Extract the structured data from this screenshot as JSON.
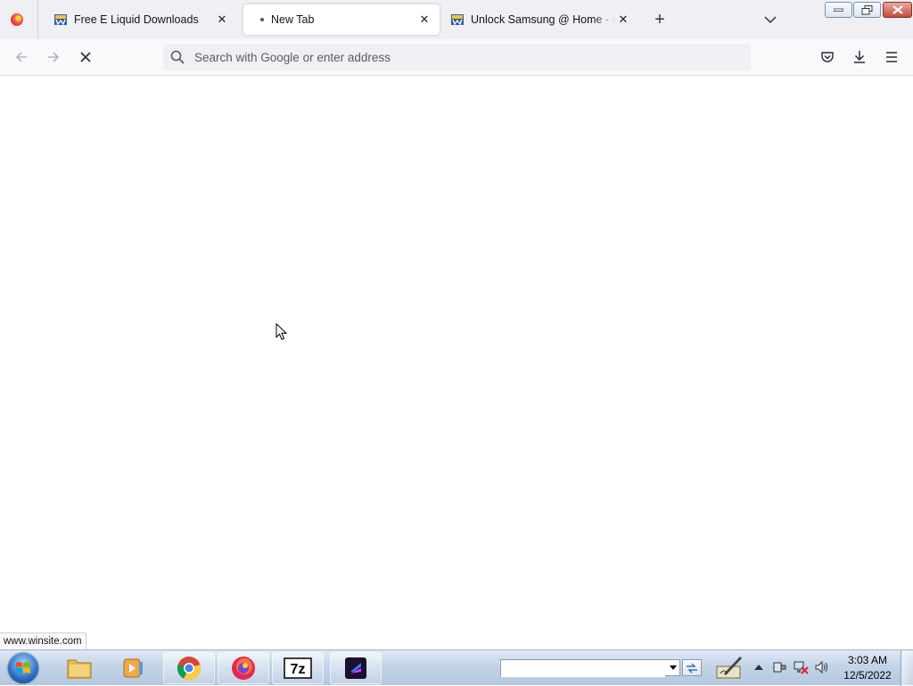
{
  "browser": {
    "tabs": [
      {
        "label": "Free E Liquid Downloads",
        "favicon": "winsite-favicon",
        "active": false
      },
      {
        "label": "New Tab",
        "favicon": "loading-dot",
        "active": true
      },
      {
        "label": "Unlock Samsung @ Home - FRE",
        "favicon": "winsite-favicon",
        "active": false
      }
    ],
    "urlbar": {
      "placeholder": "Search with Google or enter address",
      "value": ""
    },
    "status_tip": "www.winsite.com",
    "icons": {
      "back": "back-arrow-icon",
      "forward": "forward-arrow-icon",
      "stop": "stop-loading-icon",
      "pocket": "pocket-icon",
      "downloads": "download-icon",
      "menu": "hamburger-menu-icon"
    }
  },
  "taskbar": {
    "apps": [
      "windows-explorer",
      "media-player",
      "google-chrome",
      "firefox",
      "7-zip",
      "app-launcher"
    ],
    "address_input": "",
    "clock": {
      "time": "3:03 AM",
      "date": "12/5/2022"
    },
    "colors": {
      "taskbar": "#c3d4e8",
      "start": "#2a6fc4"
    }
  }
}
